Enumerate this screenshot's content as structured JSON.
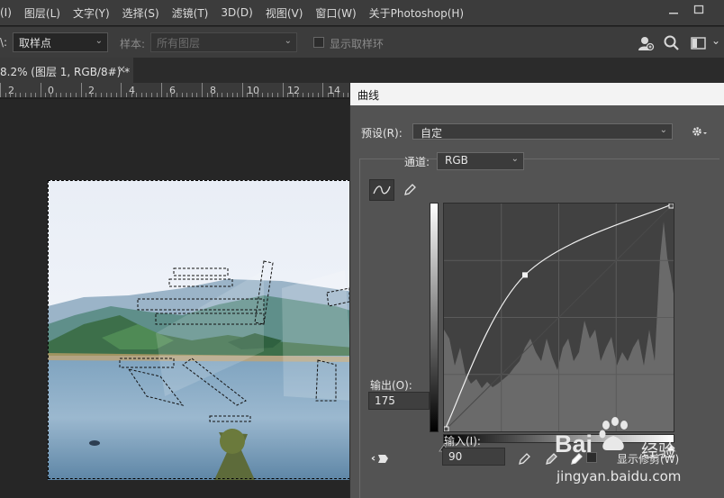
{
  "menu": {
    "items": [
      "(I)",
      "图层(L)",
      "文字(Y)",
      "选择(S)",
      "滤镜(T)",
      "3D(D)",
      "视图(V)",
      "窗口(W)",
      "关于Photoshop(H)"
    ]
  },
  "options": {
    "prefix": "\\:",
    "sample_point_value": "取样点",
    "sample_label": "样本:",
    "sample_value": "所有图层",
    "show_ring_label": "显示取样环"
  },
  "tab": {
    "title": "8.2% (图层 1, RGB/8#) *",
    "close": "×"
  },
  "ruler": {
    "numbers": [
      "2",
      "0",
      "2",
      "4",
      "6",
      "8",
      "10",
      "12",
      "14"
    ]
  },
  "curves": {
    "title": "曲线",
    "preset_label": "预设(R):",
    "preset_value": "自定",
    "channel_label": "通道:",
    "channel_value": "RGB",
    "output_label": "输出(O):",
    "output_value": "175",
    "input_label": "输入(I):",
    "input_value": "90",
    "show_clipping_label": "显示修剪(W)",
    "curve_points": [
      [
        0,
        0
      ],
      [
        90,
        175
      ],
      [
        255,
        255
      ]
    ]
  },
  "watermark": {
    "brand": "Bai",
    "brand_suffix": "经验",
    "url": "jingyan.baidu.com"
  },
  "colors": {
    "menubar": "#3c3c3c",
    "dialog_bg": "#535353",
    "graph_bg": "#414141"
  }
}
